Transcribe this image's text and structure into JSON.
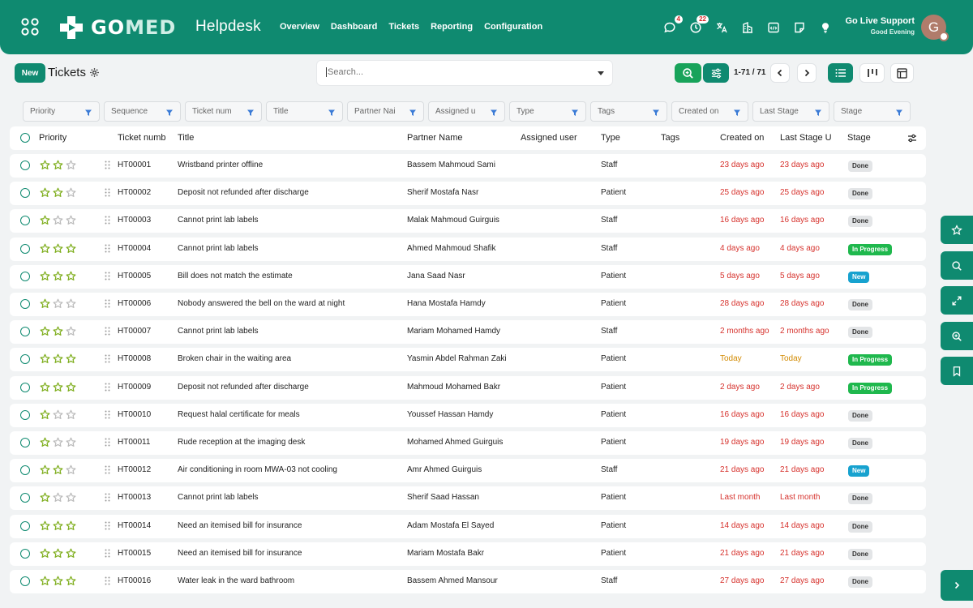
{
  "header": {
    "app_name": "Helpdesk",
    "logo_text_a": "GO",
    "logo_text_b": "MED",
    "nav": [
      "Overview",
      "Dashboard",
      "Tickets",
      "Reporting",
      "Configuration"
    ],
    "chat_badge": "4",
    "activity_badge": "22",
    "user_name": "Go Live Support",
    "user_greeting": "Good Evening",
    "avatar_letter": "G"
  },
  "controls": {
    "new_label": "New",
    "title": "Tickets",
    "search_placeholder": "Search...",
    "pager": "1-71 / 71"
  },
  "filters": [
    "Priority",
    "Sequence",
    "Ticket num",
    "Title",
    "Partner Nai",
    "Assigned u",
    "Type",
    "Tags",
    "Created on",
    "Last Stage",
    "Stage"
  ],
  "columns": [
    "Priority",
    "Ticket numb",
    "Title",
    "Partner Name",
    "Assigned user",
    "Type",
    "Tags",
    "Created on",
    "Last Stage U",
    "Stage"
  ],
  "colors": {
    "brand": "#0f8a70",
    "red_text": "#d6322d",
    "amber_text": "#d28a00",
    "star": "#7fae1e",
    "progress": "#1fb84d",
    "new": "#17a2cf"
  },
  "rows": [
    {
      "stars": 2,
      "number": "HT00001",
      "title": "Wristband printer offline",
      "partner": "Bassem Mahmoud Sami",
      "type": "Staff",
      "created": "23 days ago",
      "last": "23 days ago",
      "tone": "red",
      "stage": "Done"
    },
    {
      "stars": 2,
      "number": "HT00002",
      "title": "Deposit not refunded after discharge",
      "partner": "Sherif Mostafa Nasr",
      "type": "Patient",
      "created": "25 days ago",
      "last": "25 days ago",
      "tone": "red",
      "stage": "Done"
    },
    {
      "stars": 1,
      "number": "HT00003",
      "title": "Cannot print lab labels",
      "partner": "Malak Mahmoud Guirguis",
      "type": "Staff",
      "created": "16 days ago",
      "last": "16 days ago",
      "tone": "red",
      "stage": "Done"
    },
    {
      "stars": 3,
      "number": "HT00004",
      "title": "Cannot print lab labels",
      "partner": "Ahmed Mahmoud Shafik",
      "type": "Staff",
      "created": "4 days ago",
      "last": "4 days ago",
      "tone": "red",
      "stage": "In Progress"
    },
    {
      "stars": 3,
      "number": "HT00005",
      "title": "Bill does not match the estimate",
      "partner": "Jana Saad Nasr",
      "type": "Patient",
      "created": "5 days ago",
      "last": "5 days ago",
      "tone": "red",
      "stage": "New"
    },
    {
      "stars": 1,
      "number": "HT00006",
      "title": "Nobody answered the bell on the ward at night",
      "partner": "Hana Mostafa Hamdy",
      "type": "Patient",
      "created": "28 days ago",
      "last": "28 days ago",
      "tone": "red",
      "stage": "Done"
    },
    {
      "stars": 2,
      "number": "HT00007",
      "title": "Cannot print lab labels",
      "partner": "Mariam Mohamed Hamdy",
      "type": "Staff",
      "created": "2 months ago",
      "last": "2 months ago",
      "tone": "red",
      "stage": "Done"
    },
    {
      "stars": 3,
      "number": "HT00008",
      "title": "Broken chair in the waiting area",
      "partner": "Yasmin Abdel Rahman Zaki",
      "type": "Patient",
      "created": "Today",
      "last": "Today",
      "tone": "amber",
      "stage": "In Progress"
    },
    {
      "stars": 3,
      "number": "HT00009",
      "title": "Deposit not refunded after discharge",
      "partner": "Mahmoud Mohamed Bakr",
      "type": "Patient",
      "created": "2 days ago",
      "last": "2 days ago",
      "tone": "red",
      "stage": "In Progress"
    },
    {
      "stars": 1,
      "number": "HT00010",
      "title": "Request halal certificate for meals",
      "partner": "Youssef Hassan Hamdy",
      "type": "Patient",
      "created": "16 days ago",
      "last": "16 days ago",
      "tone": "red",
      "stage": "Done"
    },
    {
      "stars": 1,
      "number": "HT00011",
      "title": "Rude reception at the imaging desk",
      "partner": "Mohamed Ahmed Guirguis",
      "type": "Patient",
      "created": "19 days ago",
      "last": "19 days ago",
      "tone": "red",
      "stage": "Done"
    },
    {
      "stars": 2,
      "number": "HT00012",
      "title": "Air conditioning in room MWA-03 not cooling",
      "partner": "Amr Ahmed Guirguis",
      "type": "Staff",
      "created": "21 days ago",
      "last": "21 days ago",
      "tone": "red",
      "stage": "New"
    },
    {
      "stars": 1,
      "number": "HT00013",
      "title": "Cannot print lab labels",
      "partner": "Sherif Saad Hassan",
      "type": "Patient",
      "created": "Last month",
      "last": "Last month",
      "tone": "red",
      "stage": "Done"
    },
    {
      "stars": 3,
      "number": "HT00014",
      "title": "Need an itemised bill for insurance",
      "partner": "Adam Mostafa El Sayed",
      "type": "Patient",
      "created": "14 days ago",
      "last": "14 days ago",
      "tone": "red",
      "stage": "Done"
    },
    {
      "stars": 3,
      "number": "HT00015",
      "title": "Need an itemised bill for insurance",
      "partner": "Mariam Mostafa Bakr",
      "type": "Patient",
      "created": "21 days ago",
      "last": "21 days ago",
      "tone": "red",
      "stage": "Done"
    },
    {
      "stars": 3,
      "number": "HT00016",
      "title": "Water leak in the ward bathroom",
      "partner": "Bassem Ahmed Mansour",
      "type": "Staff",
      "created": "27 days ago",
      "last": "27 days ago",
      "tone": "red",
      "stage": "Done"
    }
  ]
}
